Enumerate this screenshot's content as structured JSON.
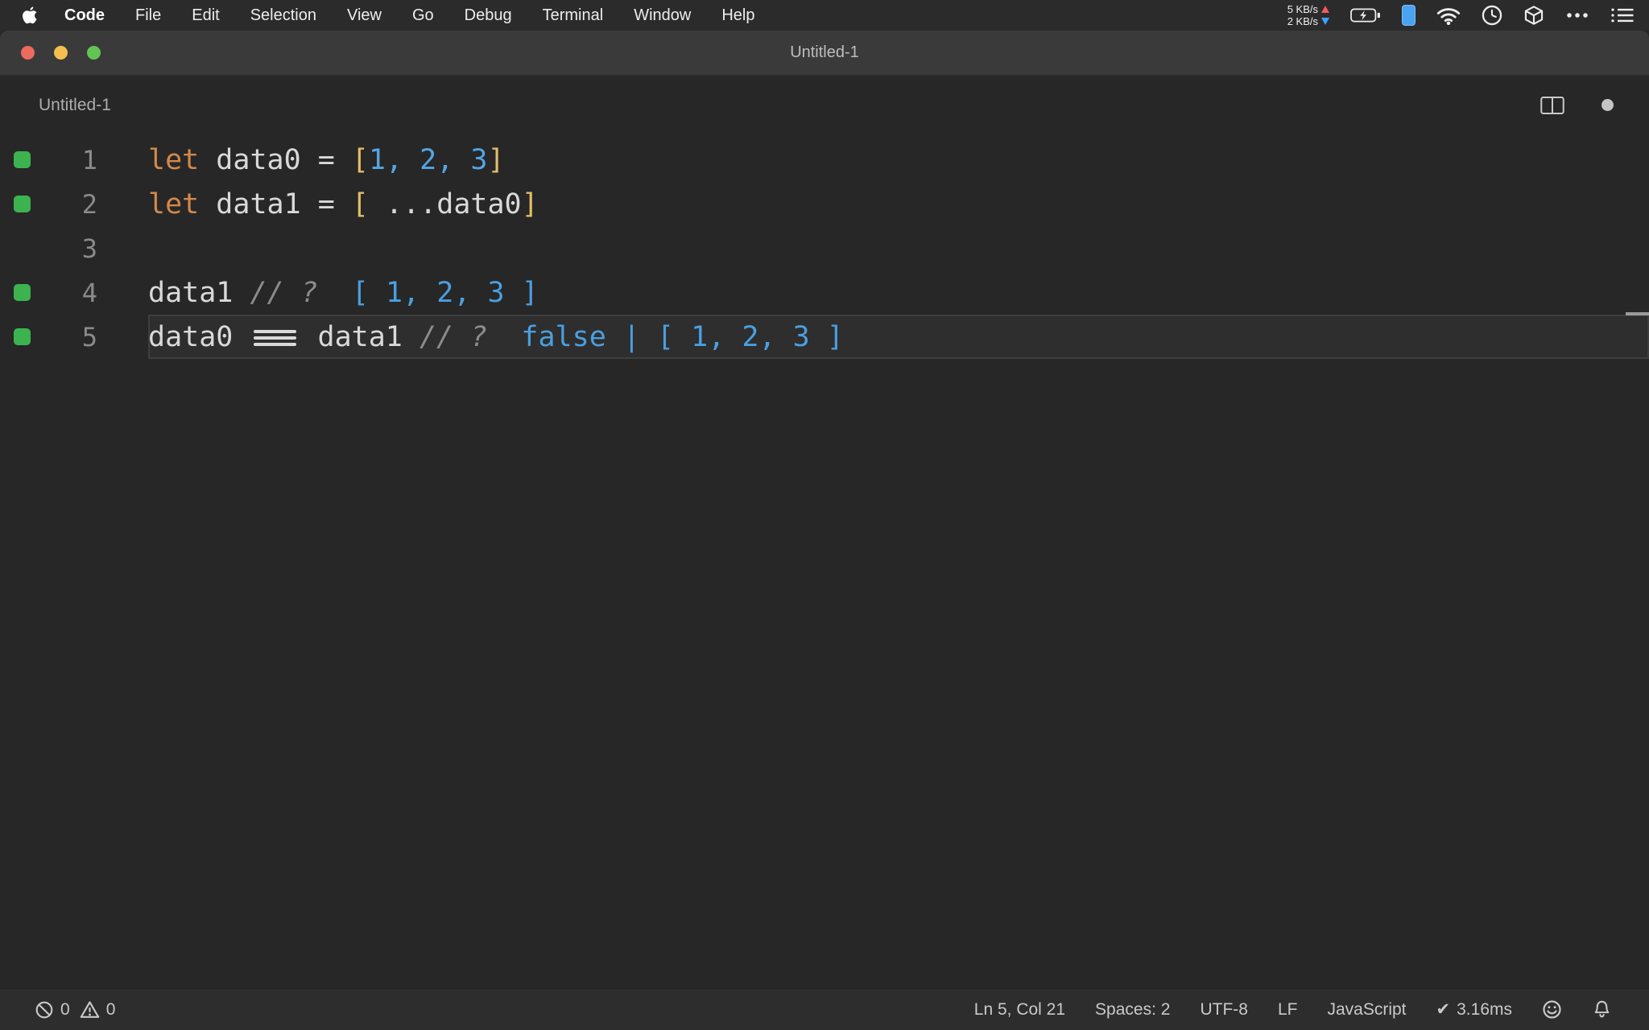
{
  "menu_bar": {
    "app_menu": "Code",
    "items": [
      "File",
      "Edit",
      "Selection",
      "View",
      "Go",
      "Debug",
      "Terminal",
      "Window",
      "Help"
    ],
    "network": {
      "up": "5 KB/s",
      "down": "2 KB/s"
    },
    "status_icons": [
      "battery-charging",
      "device-battery",
      "wifi",
      "clock",
      "cube",
      "ellipsis",
      "list"
    ]
  },
  "window": {
    "title": "Untitled-1",
    "traffic_light_colors": [
      "#ed6a5e",
      "#f4bf4f",
      "#61c554"
    ]
  },
  "editor": {
    "title": "Untitled-1",
    "modified": true,
    "language_colors": {
      "keyword": "#d2884b",
      "variable": "#d9d9d9",
      "bracket": "#e2bd68",
      "number": "#55a5e3",
      "comment": "#8c8c8c",
      "inline_result": "#4b9fe0",
      "coverage_marker": "#3cb34f"
    },
    "lines": [
      {
        "num": "1",
        "covered": true,
        "current": false,
        "tokens": [
          [
            "kw",
            "let"
          ],
          [
            "plain",
            " "
          ],
          [
            "var",
            "data0"
          ],
          [
            "plain",
            " = "
          ],
          [
            "bracket",
            "["
          ],
          [
            "num",
            "1, 2, 3"
          ],
          [
            "bracket",
            "]"
          ]
        ]
      },
      {
        "num": "2",
        "covered": true,
        "current": false,
        "tokens": [
          [
            "kw",
            "let"
          ],
          [
            "plain",
            " "
          ],
          [
            "var",
            "data1"
          ],
          [
            "plain",
            " = "
          ],
          [
            "bracket",
            "["
          ],
          [
            "plain",
            " "
          ],
          [
            "spread",
            "..."
          ],
          [
            "var",
            "data0"
          ],
          [
            "bracket",
            "]"
          ]
        ]
      },
      {
        "num": "3",
        "covered": false,
        "current": false,
        "tokens": []
      },
      {
        "num": "4",
        "covered": true,
        "current": false,
        "tokens": [
          [
            "var",
            "data1"
          ],
          [
            "plain",
            " "
          ],
          [
            "comment",
            "// ?"
          ],
          [
            "plain",
            "  "
          ],
          [
            "result",
            "[ 1, 2, 3 ]"
          ]
        ]
      },
      {
        "num": "5",
        "covered": true,
        "current": true,
        "tokens": [
          [
            "var",
            "data0"
          ],
          [
            "plain",
            " "
          ],
          [
            "eq3",
            "==="
          ],
          [
            "plain",
            " "
          ],
          [
            "var",
            "data1"
          ],
          [
            "plain",
            " "
          ],
          [
            "comment",
            "// ?"
          ],
          [
            "plain",
            "  "
          ],
          [
            "result",
            "false"
          ],
          [
            "plain",
            " "
          ],
          [
            "cursor",
            "|"
          ],
          [
            "plain",
            " "
          ],
          [
            "result",
            "[ 1, 2, 3 ]"
          ]
        ]
      }
    ]
  },
  "status_bar": {
    "errors": "0",
    "warnings": "0",
    "cursor": "Ln 5, Col 21",
    "indentation": "Spaces: 2",
    "encoding": "UTF-8",
    "eol": "LF",
    "language": "JavaScript",
    "perf_check": "✔",
    "perf": "3.16ms"
  }
}
